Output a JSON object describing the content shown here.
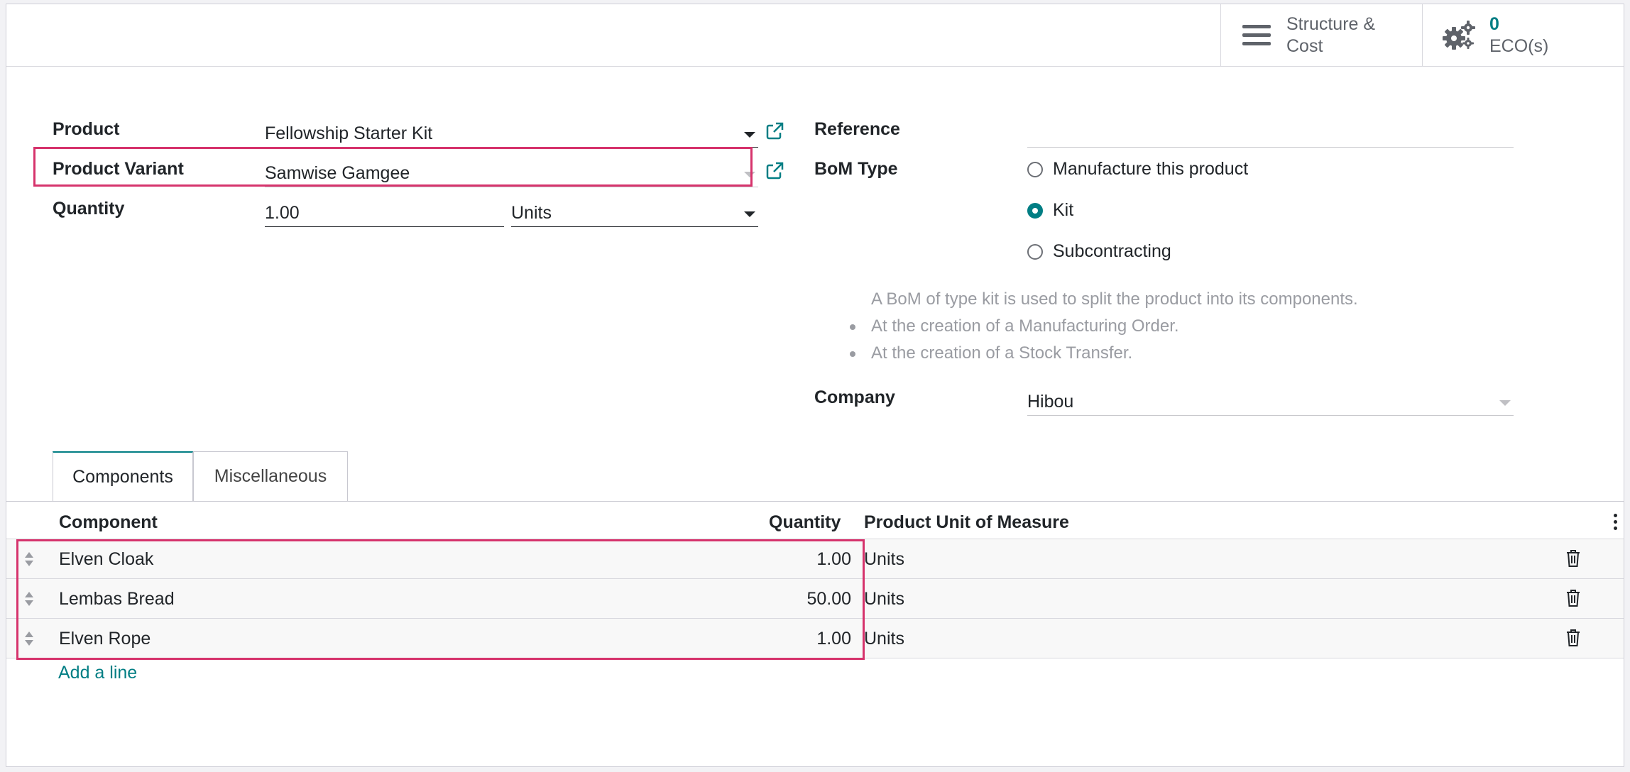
{
  "buttons": {
    "structure_cost_line1": "Structure &",
    "structure_cost_line2": "Cost",
    "eco_count": "0",
    "eco_label": "ECO(s)"
  },
  "form": {
    "product_label": "Product",
    "product_value": "Fellowship Starter Kit",
    "variant_label": "Product Variant",
    "variant_value": "Samwise Gamgee",
    "quantity_label": "Quantity",
    "quantity_value": "1.00",
    "uom_value": "Units",
    "reference_label": "Reference",
    "reference_value": "",
    "bom_type_label": "BoM Type",
    "bom_types": [
      "Manufacture this product",
      "Kit",
      "Subcontracting"
    ],
    "bom_type_selected": "Kit",
    "help_intro": "A BoM of type kit is used to split the product into its components.",
    "help_items": [
      "At the creation of a Manufacturing Order.",
      "At the creation of a Stock Transfer."
    ],
    "company_label": "Company",
    "company_value": "Hibou"
  },
  "tabs": [
    {
      "label": "Components",
      "active": true
    },
    {
      "label": "Miscellaneous",
      "active": false
    }
  ],
  "table": {
    "headers": {
      "component": "Component",
      "quantity": "Quantity",
      "uom": "Product Unit of Measure"
    },
    "rows": [
      {
        "component": "Elven Cloak",
        "quantity": "1.00",
        "uom": "Units"
      },
      {
        "component": "Lembas Bread",
        "quantity": "50.00",
        "uom": "Units"
      },
      {
        "component": "Elven Rope",
        "quantity": "1.00",
        "uom": "Units"
      }
    ],
    "add_line": "Add a line"
  },
  "colors": {
    "accent": "#017e84",
    "highlight": "#d6336c"
  }
}
